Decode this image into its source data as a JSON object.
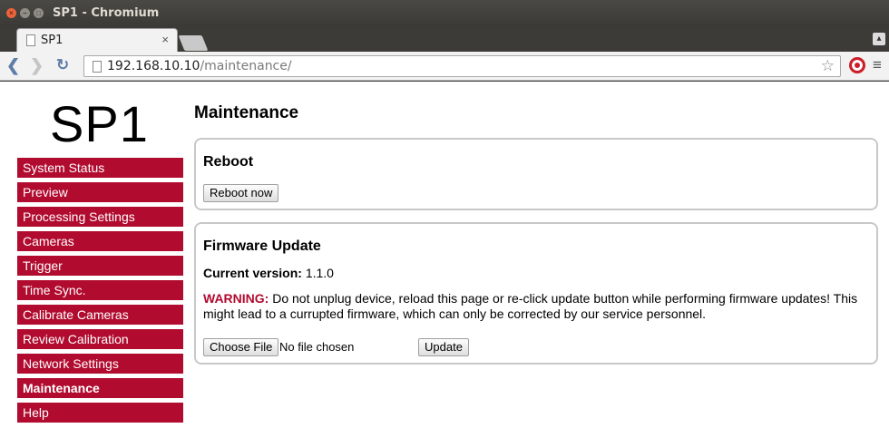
{
  "window": {
    "title": "SP1 - Chromium"
  },
  "tab": {
    "label": "SP1",
    "close": "×"
  },
  "toolbar": {
    "url_host": "192.168.10.10",
    "url_path": "/maintenance/"
  },
  "icons": {
    "back": "chevron-left-icon",
    "forward": "chevron-right-icon",
    "reload": "reload-icon",
    "star": "bookmark-star-icon",
    "menu": "hamburger-menu-icon"
  },
  "colors": {
    "accent": "#b10b2f",
    "nav_text": "#ffffff"
  },
  "page": {
    "logo": "SP1",
    "title": "Maintenance",
    "nav": [
      {
        "label": "System Status"
      },
      {
        "label": "Preview"
      },
      {
        "label": "Processing Settings"
      },
      {
        "label": "Cameras"
      },
      {
        "label": "Trigger"
      },
      {
        "label": "Time Sync."
      },
      {
        "label": "Calibrate Cameras"
      },
      {
        "label": "Review Calibration"
      },
      {
        "label": "Network Settings"
      },
      {
        "label": "Maintenance",
        "active": true
      },
      {
        "label": "Help"
      }
    ],
    "reboot": {
      "heading": "Reboot",
      "button": "Reboot now"
    },
    "firmware": {
      "heading": "Firmware Update",
      "version_label": "Current version:",
      "version_value": "1.1.0",
      "warning_label": "WARNING:",
      "warning_text": "Do not unplug device, reload this page or re-click update button while performing firmware updates! This might lead to a currupted firmware, which can only be corrected by our service personnel.",
      "choose_button": "Choose File",
      "no_file": "No file chosen",
      "update_button": "Update"
    }
  }
}
